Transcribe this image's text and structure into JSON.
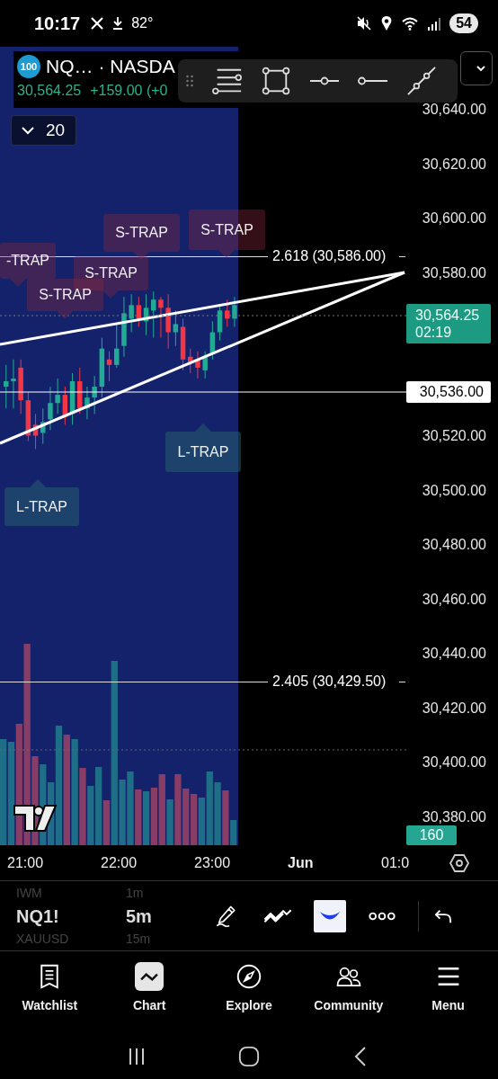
{
  "status_bar": {
    "time": "10:17",
    "temperature": "82°",
    "battery": "54"
  },
  "symbol": {
    "badge": "100",
    "name": "NQ…",
    "exchange": "· NASDA",
    "price": "30,564.25",
    "change": "+159.00 (+0"
  },
  "bars_dropdown": {
    "value": "20"
  },
  "trap_labels": [
    {
      "kind": "short",
      "text": "-TRAP"
    },
    {
      "kind": "short",
      "text": "S-TRAP"
    },
    {
      "kind": "short",
      "text": "S-TRAP"
    },
    {
      "kind": "short",
      "text": "S-TRAP"
    },
    {
      "kind": "short",
      "text": "S-TRAP"
    },
    {
      "kind": "long",
      "text": "L-TRAP"
    },
    {
      "kind": "long",
      "text": "L-TRAP"
    }
  ],
  "fib_levels": [
    {
      "label": "2.618 (30,586.00)"
    },
    {
      "label": "2.405 (30,429.50)"
    }
  ],
  "price_axis": {
    "ticks": [
      "30,640.00",
      "30,620.00",
      "30,600.00",
      "30,580.00",
      "30,520.00",
      "30,500.00",
      "30,480.00",
      "30,460.00",
      "30,440.00",
      "30,420.00",
      "30,400.00",
      "30,380.00"
    ],
    "last_price": "30,564.25",
    "countdown": "02:19",
    "line_price": "30,536.00",
    "volume_badge": "160"
  },
  "time_axis": [
    {
      "text": "21:00",
      "bold": false
    },
    {
      "text": "22:00",
      "bold": false
    },
    {
      "text": "23:00",
      "bold": false
    },
    {
      "text": "Jun",
      "bold": true
    },
    {
      "text": "01:0",
      "bold": false
    }
  ],
  "symbol_picker": [
    {
      "symbol": "IWM",
      "interval": "1m",
      "selected": false
    },
    {
      "symbol": "NQ1!",
      "interval": "5m",
      "selected": true
    },
    {
      "symbol": "XAUUSD",
      "interval": "15m",
      "selected": false
    }
  ],
  "tools": [
    {
      "kind": "brush",
      "selected": false
    },
    {
      "kind": "pattern",
      "selected": false
    },
    {
      "kind": "magnet",
      "selected": true
    },
    {
      "kind": "more",
      "selected": false
    }
  ],
  "bottom_nav": [
    {
      "label": "Watchlist",
      "selected": false
    },
    {
      "label": "Chart",
      "selected": true
    },
    {
      "label": "Explore",
      "selected": false
    },
    {
      "label": "Community",
      "selected": false
    },
    {
      "label": "Menu",
      "selected": false
    }
  ]
}
